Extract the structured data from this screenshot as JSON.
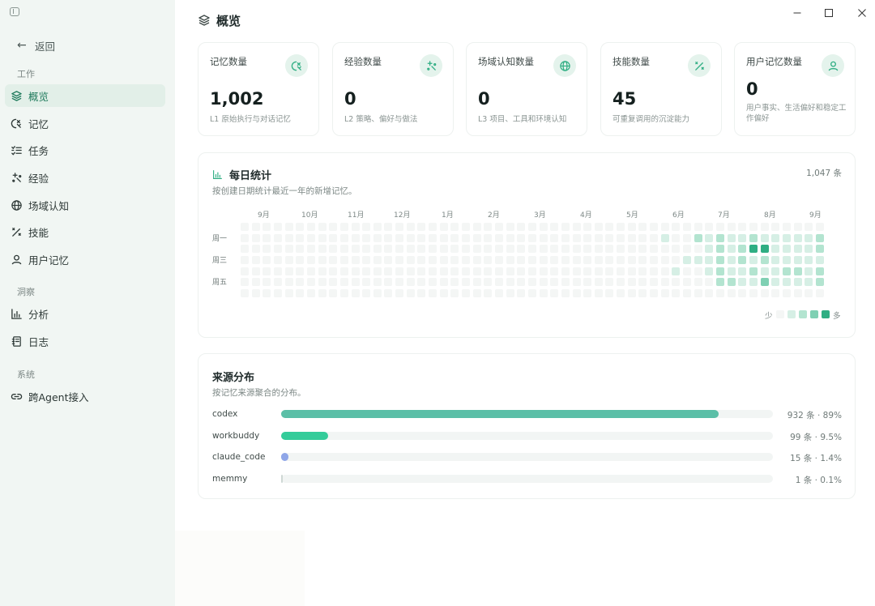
{
  "sidebar": {
    "back_label": "返回",
    "groups": [
      {
        "title": "工作"
      },
      {
        "title": "洞察"
      },
      {
        "title": "系统"
      }
    ],
    "items": [
      {
        "label": "概览",
        "icon": "layers-icon",
        "active": true
      },
      {
        "label": "记忆",
        "icon": "memory-icon"
      },
      {
        "label": "任务",
        "icon": "task-list-icon"
      },
      {
        "label": "经验",
        "icon": "sparkle-icon"
      },
      {
        "label": "场域认知",
        "icon": "globe-icon"
      },
      {
        "label": "技能",
        "icon": "wand-icon"
      },
      {
        "label": "用户记忆",
        "icon": "user-icon"
      },
      {
        "label": "分析",
        "icon": "bar-chart-icon"
      },
      {
        "label": "日志",
        "icon": "log-icon"
      },
      {
        "label": "跨Agent接入",
        "icon": "link-icon"
      }
    ]
  },
  "header": {
    "title": "概览"
  },
  "stats": [
    {
      "label": "记忆数量",
      "value": "1,002",
      "desc": "L1 原始执行与对话记忆",
      "icon": "memory-icon"
    },
    {
      "label": "经验数量",
      "value": "0",
      "desc": "L2 策略、偏好与做法",
      "icon": "sparkle-icon"
    },
    {
      "label": "场域认知数量",
      "value": "0",
      "desc": "L3 项目、工具和环境认知",
      "icon": "globe-icon"
    },
    {
      "label": "技能数量",
      "value": "45",
      "desc": "可重复调用的沉淀能力",
      "icon": "wand-icon"
    },
    {
      "label": "用户记忆数量",
      "value": "0",
      "desc": "用户事实、生活偏好和稳定工作偏好",
      "icon": "user-icon"
    }
  ],
  "daily": {
    "title": "每日统计",
    "subtitle": "按创建日期统计最近一年的新增记忆。",
    "total": "1,047 条",
    "months": [
      "9月",
      "10月",
      "11月",
      "12月",
      "1月",
      "2月",
      "3月",
      "4月",
      "5月",
      "6月",
      "7月",
      "8月",
      "9月"
    ],
    "weekdays": [
      "周一",
      "周三",
      "周五"
    ],
    "legend_less": "少",
    "legend_more": "多",
    "colors": [
      "#f4f6f5",
      "#d6efe5",
      "#b3e4d0",
      "#7fd0b3",
      "#2fae83"
    ],
    "levels": [
      [
        0,
        0,
        0,
        0,
        0,
        0,
        0,
        0,
        0,
        0,
        0,
        0,
        0,
        0,
        0,
        0,
        0,
        0,
        0,
        0,
        0,
        0,
        0,
        0,
        0,
        0,
        0,
        0,
        0,
        0,
        0,
        0,
        0,
        0,
        0,
        0,
        0,
        0,
        0,
        0,
        0,
        0,
        0,
        0,
        0,
        0,
        0,
        0,
        0,
        0,
        0,
        0,
        0
      ],
      [
        0,
        0,
        0,
        0,
        0,
        0,
        0,
        0,
        0,
        0,
        0,
        0,
        0,
        0,
        0,
        0,
        0,
        0,
        0,
        0,
        0,
        0,
        0,
        0,
        0,
        0,
        0,
        0,
        0,
        0,
        0,
        0,
        0,
        0,
        0,
        0,
        0,
        0,
        0,
        0,
        0,
        0,
        0,
        0,
        0,
        0,
        0,
        0,
        0,
        0,
        0,
        0,
        0,
        0,
        0,
        0,
        0,
        0,
        0,
        0,
        0,
        0,
        0,
        0,
        0,
        0,
        0,
        0,
        0,
        0,
        0,
        0,
        0,
        0,
        0,
        0,
        0,
        0,
        1,
        0,
        0,
        2,
        1,
        2,
        1,
        1,
        2,
        1,
        1,
        1,
        1,
        1,
        2
      ],
      [
        0,
        0,
        0,
        0,
        0,
        0,
        0,
        0,
        0,
        0,
        0,
        0,
        0,
        0,
        0,
        0,
        0,
        0,
        0,
        0,
        0,
        0,
        0,
        0,
        0,
        0,
        0,
        0,
        0,
        0,
        0,
        0,
        0,
        0,
        0,
        0,
        0,
        0,
        0,
        0,
        0,
        0,
        0,
        0,
        0,
        0,
        0,
        0,
        0,
        0,
        0,
        0,
        0,
        0,
        0,
        0,
        0,
        0,
        0,
        0,
        0,
        0,
        0,
        0,
        0,
        0,
        0,
        0,
        0,
        0,
        0,
        0,
        0,
        0,
        0,
        0,
        0,
        0,
        0,
        0,
        0,
        1,
        2,
        1,
        2,
        4,
        4,
        1,
        1,
        1,
        1,
        2
      ],
      [
        0,
        0,
        0,
        0,
        0,
        0,
        0,
        0,
        0,
        0,
        0,
        0,
        0,
        0,
        0,
        0,
        0,
        0,
        0,
        0,
        0,
        0,
        0,
        0,
        0,
        0,
        0,
        0,
        0,
        0,
        0,
        0,
        0,
        0,
        0,
        0,
        0,
        0,
        0,
        0,
        0,
        0,
        0,
        0,
        0,
        0,
        0,
        0,
        0,
        0,
        0,
        0,
        0,
        0,
        0,
        0,
        0,
        0,
        0,
        0,
        0,
        0,
        0,
        0,
        0,
        0,
        0,
        0,
        0,
        0,
        0,
        0,
        0,
        0,
        0,
        0,
        0,
        0,
        0,
        0,
        1,
        1,
        1,
        2,
        1,
        2,
        1,
        2,
        1,
        1,
        1,
        1,
        1
      ],
      [
        0,
        0,
        0,
        0,
        0,
        0,
        0,
        0,
        0,
        0,
        0,
        0,
        0,
        0,
        0,
        0,
        0,
        0,
        0,
        0,
        0,
        0,
        0,
        0,
        0,
        0,
        0,
        0,
        0,
        0,
        0,
        0,
        0,
        0,
        0,
        0,
        0,
        0,
        0,
        0,
        0,
        0,
        0,
        0,
        0,
        0,
        0,
        0,
        0,
        0,
        0,
        0,
        0,
        0,
        0,
        0,
        0,
        0,
        0,
        0,
        0,
        0,
        0,
        0,
        0,
        0,
        0,
        0,
        0,
        0,
        0,
        0,
        0,
        0,
        0,
        0,
        0,
        1,
        0,
        0,
        1,
        2,
        1,
        1,
        2,
        1,
        1,
        2,
        2,
        1,
        2
      ],
      [
        0,
        0,
        0,
        0,
        0,
        0,
        0,
        0,
        0,
        0,
        0,
        0,
        0,
        0,
        0,
        0,
        0,
        0,
        0,
        0,
        0,
        0,
        0,
        0,
        0,
        0,
        0,
        0,
        0,
        0,
        0,
        0,
        0,
        0,
        0,
        0,
        0,
        0,
        0,
        0,
        0,
        0,
        0,
        0,
        0,
        0,
        0,
        0,
        0,
        0,
        0,
        0,
        0,
        0,
        0,
        0,
        0,
        0,
        0,
        0,
        0,
        0,
        0,
        0,
        0,
        0,
        0,
        0,
        0,
        0,
        0,
        0,
        0,
        0,
        0,
        0,
        0,
        0,
        0,
        0,
        2,
        2,
        1,
        1,
        3,
        1,
        1,
        1,
        1,
        2
      ],
      [
        0,
        0,
        0,
        0,
        0,
        0,
        0,
        0,
        0,
        0,
        0,
        0,
        0,
        0,
        0,
        0,
        0,
        0,
        0,
        0,
        0,
        0,
        0,
        0,
        0,
        0,
        0,
        0,
        0,
        0,
        0,
        0,
        0,
        0,
        0,
        0,
        0,
        0,
        0,
        0,
        0,
        0,
        0,
        0,
        0,
        0,
        0,
        0,
        0,
        0,
        0,
        0,
        0,
        0,
        0
      ]
    ]
  },
  "sources": {
    "title": "来源分布",
    "subtitle": "按记忆来源聚合的分布。",
    "items": [
      {
        "name": "codex",
        "percent": 89,
        "count": "932 条 · 89%",
        "color": "#5bbfa7"
      },
      {
        "name": "workbuddy",
        "percent": 9.5,
        "count": "99 条 · 9.5%",
        "color": "#34cc9a"
      },
      {
        "name": "claude_code",
        "percent": 1.4,
        "count": "15 条 · 1.4%",
        "color": "#8fa6e8"
      },
      {
        "name": "memmy",
        "percent": 0.1,
        "count": "1 条 · 0.1%",
        "color": "#cfd8d5"
      }
    ]
  }
}
